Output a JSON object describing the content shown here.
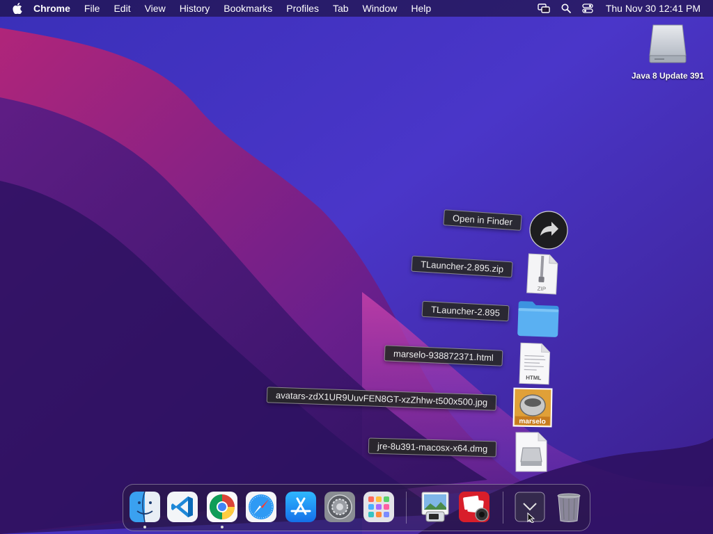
{
  "menubar": {
    "apple_icon": "apple-icon",
    "app_name": "Chrome",
    "items": [
      "File",
      "Edit",
      "View",
      "History",
      "Bookmarks",
      "Profiles",
      "Tab",
      "Window",
      "Help"
    ],
    "status_icons": [
      "screen-mirroring-icon",
      "search-icon",
      "control-center-icon"
    ],
    "clock": "Thu Nov 30  12:41 PM"
  },
  "desktop": {
    "icon_label": "Java 8 Update 391",
    "icon_name": "external-drive-icon"
  },
  "stack": {
    "open_label": "Open in Finder",
    "items": [
      {
        "label": "TLauncher-2.895.zip",
        "icon": "zip-file-icon",
        "badge": "ZIP"
      },
      {
        "label": "TLauncher-2.895",
        "icon": "folder-icon"
      },
      {
        "label": "marselo-938872371.html",
        "icon": "html-file-icon",
        "badge": "HTML"
      },
      {
        "label": "avatars-zdX1UR9UuvFEN8GT-xzZhhw-t500x500.jpg",
        "icon": "image-thumbnail-icon",
        "badge": "marselo"
      },
      {
        "label": "jre-8u391-macosx-x64.dmg",
        "icon": "disk-image-icon"
      }
    ]
  },
  "dock": {
    "apps": [
      "finder-icon",
      "vscode-icon",
      "chrome-icon",
      "safari-icon",
      "app-store-icon",
      "system-preferences-icon",
      "launchpad-icon",
      "preview-icon",
      "photo-booth-icon",
      "downloads-stack-icon",
      "trash-icon"
    ]
  },
  "colors": {
    "accent": "#4aa7ff",
    "menubar": "#1e1030"
  }
}
